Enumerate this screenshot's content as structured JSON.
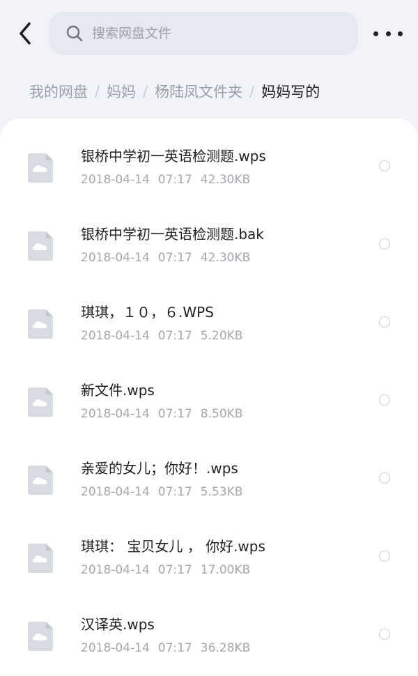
{
  "header": {
    "search": {
      "placeholder": "搜索网盘文件",
      "icon": "search-icon"
    },
    "back_icon": "chevron-left-icon",
    "more_icon": "more-horizontal-icon"
  },
  "breadcrumb": [
    "我的网盘",
    "妈妈",
    "杨陆凤文件夹",
    "妈妈写的"
  ],
  "files": [
    {
      "name": "银桥中学初一英语检测题.wps",
      "date": "2018-04-14",
      "time": "07:17",
      "size": "42.30KB"
    },
    {
      "name": "银桥中学初一英语检测题.bak",
      "date": "2018-04-14",
      "time": "07:17",
      "size": "42.30KB"
    },
    {
      "name": "琪琪，１０，６.WPS",
      "date": "2018-04-14",
      "time": "07:17",
      "size": "5.20KB"
    },
    {
      "name": "新文件.wps",
      "date": "2018-04-14",
      "time": "07:17",
      "size": "8.50KB"
    },
    {
      "name": "亲爱的女儿；你好！.wps",
      "date": "2018-04-14",
      "time": "07:17",
      "size": "5.53KB"
    },
    {
      "name": "琪琪： 宝贝女儿 ， 你好.wps",
      "date": "2018-04-14",
      "time": "07:17",
      "size": "17.00KB"
    },
    {
      "name": "汉译英.wps",
      "date": "2018-04-14",
      "time": "07:17",
      "size": "36.28KB"
    }
  ],
  "colors": {
    "background": "#f1f3f8",
    "panel": "#ffffff",
    "search_bg": "#e6e9f0",
    "breadcrumb_inactive": "#9aa0ab",
    "breadcrumb_active": "#1d1d1f",
    "meta_text": "#a4a8b0",
    "file_icon": "#d8dbe1"
  }
}
